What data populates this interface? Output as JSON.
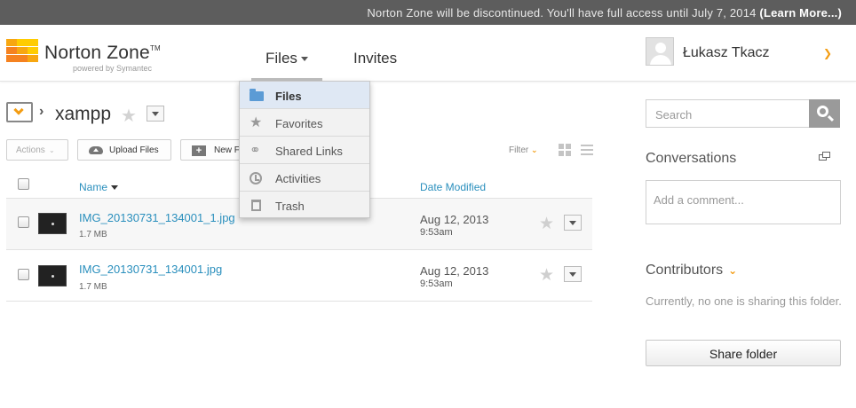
{
  "notice": {
    "message": "Norton Zone will be discontinued. You'll have full access until July 7, 2014",
    "link": "(Learn More...)"
  },
  "brand": {
    "name": "Norton Zone",
    "trademark": "TM",
    "tagline": "powered by Symantec",
    "colors": [
      "#f7a711",
      "#f58220",
      "#ffcc00"
    ]
  },
  "nav": {
    "files": "Files",
    "invites": "Invites"
  },
  "user": {
    "name": "Łukasz Tkacz",
    "caret": "⌄"
  },
  "folder": {
    "icon": "folder-check-icon",
    "separator": "›",
    "name": "xampp",
    "star": "★"
  },
  "toolbar": {
    "actions": "Actions",
    "upload": "Upload Files",
    "new": "New F",
    "filter": "Filter"
  },
  "columns": {
    "name": "Name",
    "date": "Date Modified"
  },
  "files": [
    {
      "name": "IMG_20130731_134001_1.jpg",
      "size": "1.7 MB",
      "date": "Aug 12, 2013",
      "time": "9:53am"
    },
    {
      "name": "IMG_20130731_134001.jpg",
      "size": "1.7 MB",
      "date": "Aug 12, 2013",
      "time": "9:53am"
    }
  ],
  "menu": {
    "items": [
      {
        "label": "Files",
        "icon": "folder-icon"
      },
      {
        "label": "Favorites",
        "icon": "star-icon"
      },
      {
        "label": "Shared Links",
        "icon": "link-icon"
      },
      {
        "label": "Activities",
        "icon": "clock-icon"
      },
      {
        "label": "Trash",
        "icon": "trash-icon"
      }
    ],
    "active": "Files"
  },
  "sidebar": {
    "search_placeholder": "Search",
    "conversations_title": "Conversations",
    "comment_placeholder": "Add a comment...",
    "contributors_title": "Contributors",
    "contributors_message": "Currently, no one is sharing this folder.",
    "share_button": "Share folder"
  },
  "colors": {
    "accent": "#f39c12",
    "link": "#2a8fbd",
    "notice_bg": "#5d5d5d"
  }
}
